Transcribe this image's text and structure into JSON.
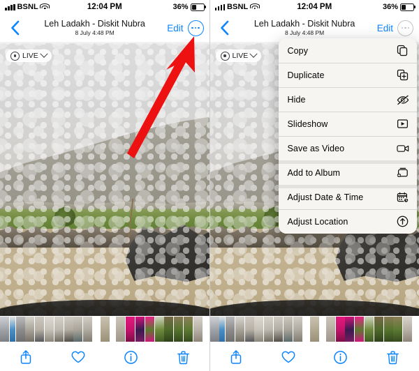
{
  "panels": [
    {
      "id": "left",
      "status_bar": {
        "carrier": "BSNL",
        "signal_icon": "signal-bars-icon",
        "wifi_icon": "wifi-icon",
        "time": "12:04 PM",
        "battery_percent": "36%",
        "battery_icon": "battery-icon"
      },
      "nav_bar": {
        "back_icon": "chevron-left-icon",
        "title": "Leh Ladakh - Diskit Nubra",
        "subtitle": "8 July  4:48 PM",
        "edit_label": "Edit",
        "more_icon": "ellipsis-circle-icon",
        "more_state": "enabled"
      },
      "photo": {
        "live_badge": {
          "label": "LIVE",
          "icon": "live-photo-icon",
          "chevron_icon": "chevron-down-icon"
        }
      },
      "menu_open": false,
      "arrow": {
        "color": "#ee1111",
        "from": "182,215",
        "to": "276,53",
        "points_at": "ellipsis-circle-icon"
      }
    },
    {
      "id": "right",
      "status_bar": {
        "carrier": "BSNL",
        "signal_icon": "signal-bars-icon",
        "wifi_icon": "wifi-icon",
        "time": "12:04 PM",
        "battery_percent": "36%",
        "battery_icon": "battery-icon"
      },
      "nav_bar": {
        "back_icon": "chevron-left-icon",
        "title": "Leh Ladakh - Diskit Nubra",
        "subtitle": "8 July  4:48 PM",
        "edit_label": "Edit",
        "more_icon": "ellipsis-circle-icon",
        "more_state": "dimmed"
      },
      "photo": {
        "live_badge": {
          "label": "LIVE",
          "icon": "live-photo-icon",
          "chevron_icon": "chevron-down-icon"
        }
      },
      "menu_open": true,
      "arrow": {
        "color": "#ee1111",
        "from": "345,245",
        "to": "403,115",
        "points_at": "menu-item-duplicate"
      }
    }
  ],
  "context_menu": {
    "items": [
      {
        "label": "Copy",
        "icon": "copy-icon",
        "group_start": false
      },
      {
        "label": "Duplicate",
        "icon": "duplicate-icon",
        "group_start": false
      },
      {
        "label": "Hide",
        "icon": "eye-slash-icon",
        "group_start": false
      },
      {
        "label": "Slideshow",
        "icon": "slideshow-play-icon",
        "group_start": false
      },
      {
        "label": "Save as Video",
        "icon": "video-camera-icon",
        "group_start": false
      },
      {
        "label": "Add to Album",
        "icon": "add-to-album-icon",
        "group_start": true
      },
      {
        "label": "Adjust Date & Time",
        "icon": "calendar-clock-icon",
        "group_start": true
      },
      {
        "label": "Adjust Location",
        "icon": "location-arrow-icon",
        "group_start": false
      }
    ]
  },
  "toolbar": {
    "items": [
      {
        "name": "share-icon",
        "label": "Share"
      },
      {
        "name": "heart-icon",
        "label": "Favorite"
      },
      {
        "name": "info-icon",
        "label": "Info"
      },
      {
        "name": "trash-icon",
        "label": "Delete"
      }
    ]
  },
  "filmstrip": {
    "thumbnails": [
      {
        "w": 13,
        "colors": [
          "#cfd2d6",
          "#9fa3a8",
          "#7b7f84"
        ]
      },
      {
        "w": 8,
        "colors": [
          "#e7e6e2",
          "#4a8ec4",
          "#2f6ea6"
        ]
      },
      {
        "w": 13,
        "colors": [
          "#bdbdbd",
          "#8c8c8c",
          "#6e6e6e"
        ]
      },
      {
        "w": 13,
        "colors": [
          "#d9d6d0",
          "#a8a49a",
          "#746f64"
        ]
      },
      {
        "w": 13,
        "colors": [
          "#cfcac2",
          "#b6b0a5",
          "#55565a"
        ]
      },
      {
        "w": 13,
        "colors": [
          "#dedad2",
          "#c7c2b8",
          "#8a8579"
        ]
      },
      {
        "w": 13,
        "colors": [
          "#d6d2ca",
          "#bdb8ad",
          "#6d6a61"
        ]
      },
      {
        "w": 13,
        "colors": [
          "#d0ccc4",
          "#b2ada2",
          "#4f4d47"
        ]
      },
      {
        "w": 13,
        "colors": [
          "#cdc8bf",
          "#a9a499",
          "#59696b"
        ]
      },
      {
        "w": 13,
        "colors": [
          "#d2cec6",
          "#b0aba0",
          "#7e7a70"
        ]
      },
      {
        "w": 10,
        "colors": [
          "#ffffff",
          "#ffffff",
          "#ffffff"
        ]
      },
      {
        "w": 13,
        "colors": [
          "#cbc3b2",
          "#b3a992",
          "#9a8f77"
        ]
      },
      {
        "w": 8,
        "colors": [
          "#ffffff",
          "#ffffff",
          "#ffffff"
        ]
      },
      {
        "w": 13,
        "colors": [
          "#cdc7bb",
          "#b5aea0",
          "#9d9588"
        ]
      },
      {
        "w": 13,
        "colors": [
          "#e5197f",
          "#c4126b",
          "#7a1046"
        ]
      },
      {
        "w": 13,
        "colors": [
          "#d9127a",
          "#3a1b4f",
          "#7a1b62"
        ]
      },
      {
        "w": 13,
        "colors": [
          "#ef1f8c",
          "#5a7a2e",
          "#d0147c"
        ]
      },
      {
        "w": 13,
        "colors": [
          "#cfd6c2",
          "#6f8a3c",
          "#3f5a22"
        ]
      },
      {
        "w": 13,
        "colors": [
          "#7a6a4a",
          "#4e6a2a",
          "#2f3f1a"
        ]
      },
      {
        "w": 13,
        "colors": [
          "#8a7a56",
          "#55742e",
          "#33471c"
        ]
      },
      {
        "w": 13,
        "colors": [
          "#8f7f5b",
          "#5c7a32",
          "#36491e"
        ]
      },
      {
        "w": 13,
        "colors": [
          "#d8d3cc",
          "#b7b0a6",
          "#8d8478"
        ]
      }
    ]
  }
}
